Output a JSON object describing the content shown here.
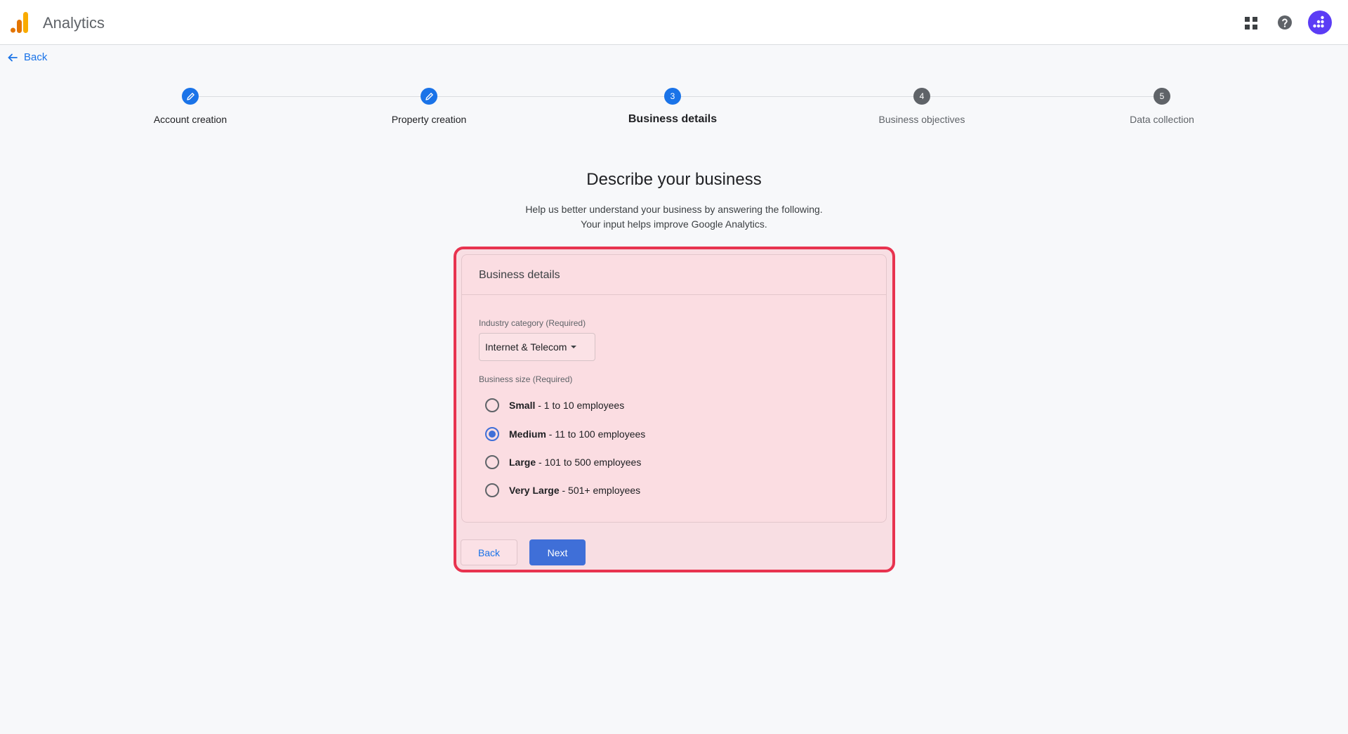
{
  "app": {
    "title": "Analytics"
  },
  "nav": {
    "back_label": "Back"
  },
  "stepper": {
    "steps": [
      {
        "label": "Account creation",
        "state": "done",
        "number": ""
      },
      {
        "label": "Property creation",
        "state": "done",
        "number": ""
      },
      {
        "label": "Business details",
        "state": "active",
        "number": "3"
      },
      {
        "label": "Business objectives",
        "state": "todo",
        "number": "4"
      },
      {
        "label": "Data collection",
        "state": "todo",
        "number": "5"
      }
    ]
  },
  "page": {
    "heading": "Describe your business",
    "subtext_line1": "Help us better understand your business by answering the following.",
    "subtext_line2": "Your input helps improve Google Analytics."
  },
  "card": {
    "title": "Business details",
    "industry_label": "Industry category (Required)",
    "industry_value": "Internet & Telecom",
    "size_label": "Business size (Required)",
    "size_options": [
      {
        "name": "Small",
        "detail": " - 1 to 10 employees",
        "checked": false
      },
      {
        "name": "Medium",
        "detail": " - 11 to 100 employees",
        "checked": true
      },
      {
        "name": "Large",
        "detail": " - 101 to 500 employees",
        "checked": false
      },
      {
        "name": "Very Large",
        "detail": " - 501+ employees",
        "checked": false
      }
    ]
  },
  "actions": {
    "back_label": "Back",
    "next_label": "Next"
  },
  "colors": {
    "accent": "#1a73e8",
    "highlight": "#e8334f",
    "button": "#3f6fd8",
    "avatar": "#5b3cf5"
  },
  "icons": [
    "analytics-logo",
    "apps-grid-icon",
    "help-icon",
    "avatar-icon",
    "arrow-left-icon",
    "pencil-icon"
  ]
}
